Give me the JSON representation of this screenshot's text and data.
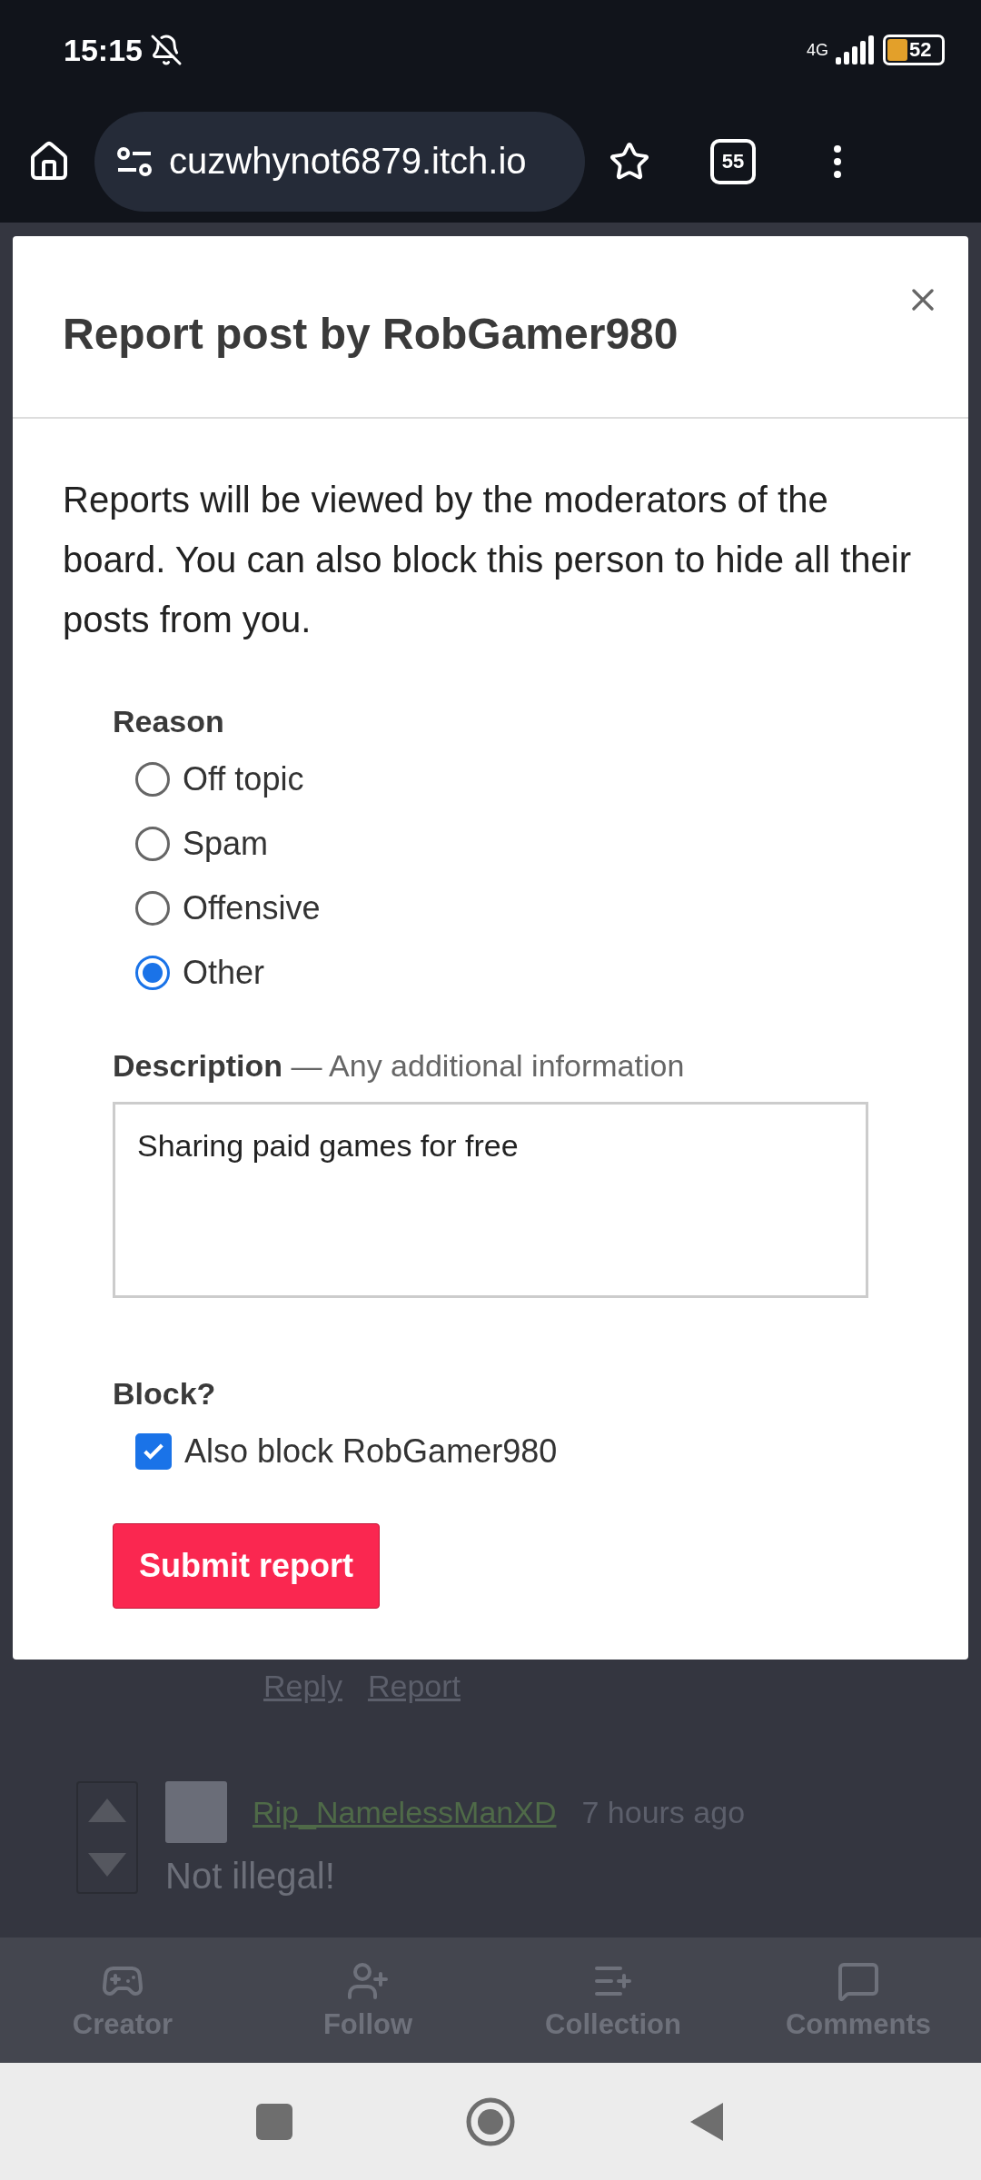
{
  "status_bar": {
    "time": "15:15",
    "network": "4G",
    "battery": "52"
  },
  "browser": {
    "url": "cuzwhynot6879.itch.io",
    "tab_count": "55"
  },
  "dialog": {
    "title": "Report post by RobGamer980",
    "intro": "Reports will be viewed by the moderators of the board. You can also block this person to hide all their posts from you.",
    "reason_label": "Reason",
    "reasons": [
      {
        "label": "Off topic",
        "selected": false
      },
      {
        "label": "Spam",
        "selected": false
      },
      {
        "label": "Offensive",
        "selected": false
      },
      {
        "label": "Other",
        "selected": true
      }
    ],
    "description_label": "Description",
    "description_hint": "— Any additional information",
    "description_value": "Sharing paid games for free",
    "block_label": "Block?",
    "block_option": {
      "label": "Also block RobGamer980",
      "checked": true
    },
    "submit": "Submit report"
  },
  "post_links": [
    "Reply",
    "Report"
  ],
  "comment": {
    "author": "Rip_NamelessManXD",
    "time": "7 hours ago",
    "text": "Not illegal!"
  },
  "bottom_nav": [
    "Creator",
    "Follow",
    "Collection",
    "Comments"
  ]
}
